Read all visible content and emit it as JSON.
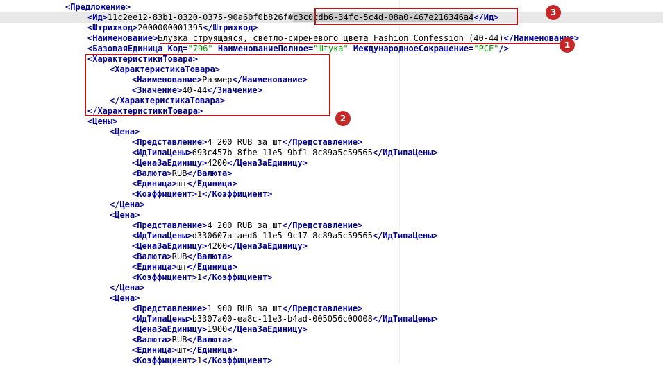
{
  "colors": {
    "tag": "#000096",
    "text": "#000000",
    "attr_value": "#009600",
    "selection_bg": "#c8c8c8",
    "current_line_bg": "#e8e8e8",
    "annotation": "#b31b1b",
    "marker_bg": "#c62828"
  },
  "editor": {
    "lines": [
      {
        "tokens": [
          {
            "t": "tag",
            "v": "<Предложение>"
          }
        ]
      },
      {
        "current": true,
        "tokens": [
          {
            "t": "tag",
            "v": "<Ид>"
          },
          {
            "t": "txt",
            "v": "11c2ee12-83b1-0320-0375-90a60f0b826f#"
          },
          {
            "t": "sel",
            "v": "c3c0cdb6-34fc-5c4d-08a0-467e216346a4"
          },
          {
            "t": "tag",
            "v": "</Ид>"
          }
        ]
      },
      {
        "tokens": [
          {
            "t": "tag",
            "v": "<Штрихкод>"
          },
          {
            "t": "txt",
            "v": "2000000001395"
          },
          {
            "t": "tag",
            "v": "</Штрихкод>"
          }
        ]
      },
      {
        "tokens": [
          {
            "t": "tag",
            "v": "<Наименование>"
          },
          {
            "t": "txt",
            "v": "Блузка струящаяся, светло-сиреневого цвета Fashion Confession (40-44)"
          },
          {
            "t": "tag",
            "v": "</Наименование>"
          }
        ]
      },
      {
        "tokens": [
          {
            "t": "tag",
            "v": "<БазоваяЕдиница"
          },
          {
            "t": "txt",
            "v": " "
          },
          {
            "t": "attr",
            "v": "Код"
          },
          {
            "t": "tag",
            "v": "="
          },
          {
            "t": "val",
            "v": "\"796\""
          },
          {
            "t": "txt",
            "v": " "
          },
          {
            "t": "attr",
            "v": "НаименованиеПолное"
          },
          {
            "t": "tag",
            "v": "="
          },
          {
            "t": "val",
            "v": "\"Штука\""
          },
          {
            "t": "txt",
            "v": " "
          },
          {
            "t": "attr",
            "v": "МеждународноеСокращение"
          },
          {
            "t": "tag",
            "v": "="
          },
          {
            "t": "val",
            "v": "\"PCE\""
          },
          {
            "t": "tag",
            "v": "/>"
          }
        ]
      },
      {
        "tokens": [
          {
            "t": "tag",
            "v": "<ХарактеристикиТовара>"
          }
        ]
      },
      {
        "tokens": [
          {
            "t": "tag",
            "v": "<ХарактеристикаТовара>"
          }
        ]
      },
      {
        "tokens": [
          {
            "t": "tag",
            "v": "<Наименование>"
          },
          {
            "t": "txt",
            "v": "Размер"
          },
          {
            "t": "tag",
            "v": "</Наименование>"
          }
        ]
      },
      {
        "tokens": [
          {
            "t": "tag",
            "v": "<Значение>"
          },
          {
            "t": "txt",
            "v": "40-44"
          },
          {
            "t": "tag",
            "v": "</Значение>"
          }
        ]
      },
      {
        "tokens": [
          {
            "t": "tag",
            "v": "</ХарактеристикаТовара>"
          }
        ]
      },
      {
        "tokens": [
          {
            "t": "tag",
            "v": "</ХарактеристикиТовара>"
          }
        ]
      },
      {
        "tokens": [
          {
            "t": "tag",
            "v": "<Цены>"
          }
        ]
      },
      {
        "tokens": [
          {
            "t": "tag",
            "v": "<Цена>"
          }
        ]
      },
      {
        "tokens": [
          {
            "t": "tag",
            "v": "<Представление>"
          },
          {
            "t": "txt",
            "v": "4 200 RUB за шт"
          },
          {
            "t": "tag",
            "v": "</Представление>"
          }
        ]
      },
      {
        "tokens": [
          {
            "t": "tag",
            "v": "<ИдТипаЦены>"
          },
          {
            "t": "txt",
            "v": "693c457b-8fbe-11e5-9bf1-8c89a5c59565"
          },
          {
            "t": "tag",
            "v": "</ИдТипаЦены>"
          }
        ]
      },
      {
        "tokens": [
          {
            "t": "tag",
            "v": "<ЦенаЗаЕдиницу>"
          },
          {
            "t": "txt",
            "v": "4200"
          },
          {
            "t": "tag",
            "v": "</ЦенаЗаЕдиницу>"
          }
        ]
      },
      {
        "tokens": [
          {
            "t": "tag",
            "v": "<Валюта>"
          },
          {
            "t": "txt",
            "v": "RUB"
          },
          {
            "t": "tag",
            "v": "</Валюта>"
          }
        ]
      },
      {
        "tokens": [
          {
            "t": "tag",
            "v": "<Единица>"
          },
          {
            "t": "txt",
            "v": "шт"
          },
          {
            "t": "tag",
            "v": "</Единица>"
          }
        ]
      },
      {
        "tokens": [
          {
            "t": "tag",
            "v": "<Коэффициент>"
          },
          {
            "t": "txt",
            "v": "1"
          },
          {
            "t": "tag",
            "v": "</Коэффициент>"
          }
        ]
      },
      {
        "tokens": [
          {
            "t": "tag",
            "v": "</Цена>"
          }
        ]
      },
      {
        "tokens": [
          {
            "t": "tag",
            "v": "<Цена>"
          }
        ]
      },
      {
        "tokens": [
          {
            "t": "tag",
            "v": "<Представление>"
          },
          {
            "t": "txt",
            "v": "4 200 RUB за шт"
          },
          {
            "t": "tag",
            "v": "</Представление>"
          }
        ]
      },
      {
        "tokens": [
          {
            "t": "tag",
            "v": "<ИдТипаЦены>"
          },
          {
            "t": "txt",
            "v": "d330607a-aed6-11e5-9c17-8c89a5c59565"
          },
          {
            "t": "tag",
            "v": "</ИдТипаЦены>"
          }
        ]
      },
      {
        "tokens": [
          {
            "t": "tag",
            "v": "<ЦенаЗаЕдиницу>"
          },
          {
            "t": "txt",
            "v": "4200"
          },
          {
            "t": "tag",
            "v": "</ЦенаЗаЕдиницу>"
          }
        ]
      },
      {
        "tokens": [
          {
            "t": "tag",
            "v": "<Валюта>"
          },
          {
            "t": "txt",
            "v": "RUB"
          },
          {
            "t": "tag",
            "v": "</Валюта>"
          }
        ]
      },
      {
        "tokens": [
          {
            "t": "tag",
            "v": "<Единица>"
          },
          {
            "t": "txt",
            "v": "шт"
          },
          {
            "t": "tag",
            "v": "</Единица>"
          }
        ]
      },
      {
        "tokens": [
          {
            "t": "tag",
            "v": "<Коэффициент>"
          },
          {
            "t": "txt",
            "v": "1"
          },
          {
            "t": "tag",
            "v": "</Коэффициент>"
          }
        ]
      },
      {
        "tokens": [
          {
            "t": "tag",
            "v": "</Цена>"
          }
        ]
      },
      {
        "tokens": [
          {
            "t": "tag",
            "v": "<Цена>"
          }
        ]
      },
      {
        "tokens": [
          {
            "t": "tag",
            "v": "<Представление>"
          },
          {
            "t": "txt",
            "v": "1 900 RUB за шт"
          },
          {
            "t": "tag",
            "v": "</Представление>"
          }
        ]
      },
      {
        "tokens": [
          {
            "t": "tag",
            "v": "<ИдТипаЦены>"
          },
          {
            "t": "txt",
            "v": "b3307a00-ea8c-11e3-b4ad-005056c00008"
          },
          {
            "t": "tag",
            "v": "</ИдТипаЦены>"
          }
        ]
      },
      {
        "tokens": [
          {
            "t": "tag",
            "v": "<ЦенаЗаЕдиницу>"
          },
          {
            "t": "txt",
            "v": "1900"
          },
          {
            "t": "tag",
            "v": "</ЦенаЗаЕдиницу>"
          }
        ]
      },
      {
        "tokens": [
          {
            "t": "tag",
            "v": "<Валюта>"
          },
          {
            "t": "txt",
            "v": "RUB"
          },
          {
            "t": "tag",
            "v": "</Валюта>"
          }
        ]
      },
      {
        "tokens": [
          {
            "t": "tag",
            "v": "<Единица>"
          },
          {
            "t": "txt",
            "v": "шт"
          },
          {
            "t": "tag",
            "v": "</Единица>"
          }
        ]
      },
      {
        "tokens": [
          {
            "t": "tag",
            "v": "<Коэффициент>"
          },
          {
            "t": "txt",
            "v": "1"
          },
          {
            "t": "tag",
            "v": "</Коэффициент>"
          }
        ]
      }
    ]
  },
  "annotations": {
    "marker_1": "1",
    "marker_2": "2",
    "marker_3": "3"
  }
}
